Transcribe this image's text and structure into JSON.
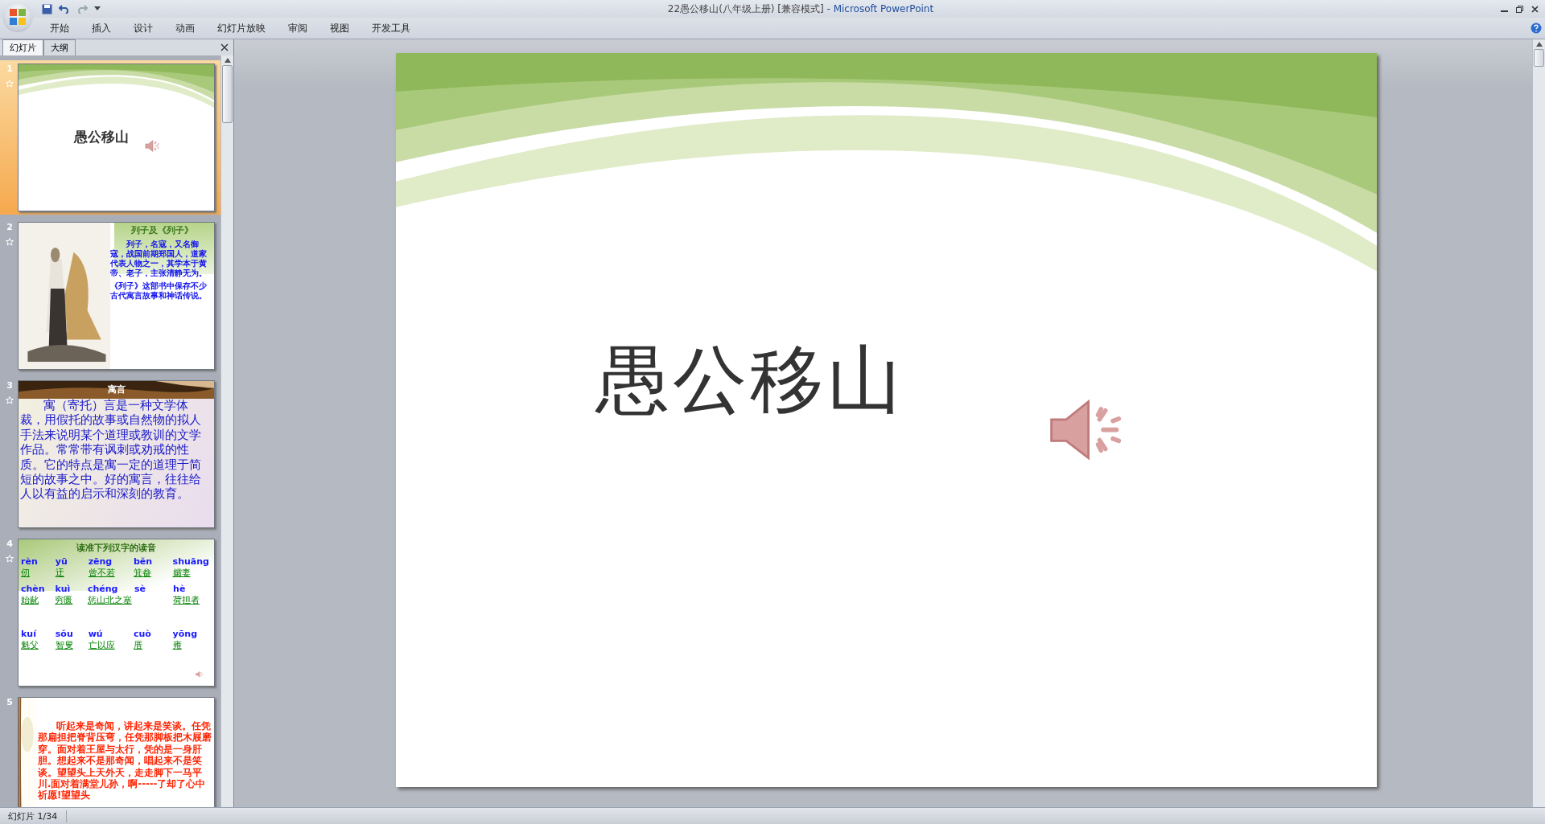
{
  "window": {
    "title": "22愚公移山(八年级上册) [兼容模式]",
    "app": " - Microsoft PowerPoint"
  },
  "ribbon_tabs": [
    "开始",
    "插入",
    "设计",
    "动画",
    "幻灯片放映",
    "审阅",
    "视图",
    "开发工具"
  ],
  "panel_tabs": [
    {
      "label": "幻灯片",
      "selected": true
    },
    {
      "label": "大纲",
      "selected": false
    }
  ],
  "slides": [
    {
      "number": "1",
      "selected": true,
      "animated": true,
      "kind": "title",
      "title": "愚公移山",
      "has_sound": true
    },
    {
      "number": "2",
      "selected": false,
      "animated": true,
      "kind": "picture_text",
      "heading": "列子及《列子》",
      "paragraphs": [
        "列子，名寇，又名御寇，战国前期郑国人，道家代表人物之一，其学本于黄帝、老子，主张清静无为。",
        "《列子》这部书中保存不少古代寓言故事和神话传说。"
      ]
    },
    {
      "number": "3",
      "selected": false,
      "animated": true,
      "kind": "text",
      "heading": "寓言",
      "paragraphs": [
        "寓（寄托）言是一种文学体裁，用假托的故事或自然物的拟人手法来说明某个道理或教训的文学作品。常常带有讽刺或劝戒的性质。它的特点是寓一定的道理于简短的故事之中。好的寓言，往往给人以有益的启示和深刻的教育。"
      ]
    },
    {
      "number": "4",
      "selected": false,
      "animated": true,
      "kind": "pinyin",
      "heading": "读准下列汉字的读音",
      "has_sound": true,
      "rows": [
        [
          {
            "pinyin": "rèn",
            "chars": "仞"
          },
          {
            "pinyin": "yū",
            "chars": "迂"
          },
          {
            "pinyin": "zēng",
            "chars": "曾不若"
          },
          {
            "pinyin": "běn",
            "chars": "箕畚"
          },
          {
            "pinyin": "shuāng",
            "chars": "孀妻"
          }
        ],
        [
          {
            "pinyin": "chèn",
            "chars": "始龀"
          },
          {
            "pinyin": "kuì",
            "chars": "穷匮"
          },
          {
            "pinyin": "chéng",
            "chars": "惩山北之塞"
          },
          {
            "pinyin": "sè"
          },
          {
            "pinyin": "hè",
            "chars": "荷担者"
          }
        ],
        [
          {
            "pinyin": "kuí",
            "chars": "魁父"
          },
          {
            "pinyin": "sǒu",
            "chars": "智叟"
          },
          {
            "pinyin": "wú",
            "chars": "亡以应"
          },
          {
            "pinyin": "cuò",
            "chars": "厝"
          },
          {
            "pinyin": "yōng",
            "chars": "雍"
          }
        ]
      ]
    },
    {
      "number": "5",
      "selected": false,
      "animated": false,
      "kind": "poem",
      "paragraphs": [
        "听起来是奇闻，讲起来是笑谈。任凭那扁担把脊背压弯，任凭那脚板把木屐磨穿。面对着王屋与太行，凭的是一身肝胆。想起来不是那奇闻，唱起来不是笑谈。望望头上天外天，走走脚下一马平川.面对着满堂儿孙，啊-----了却了心中祈愿!望望头"
      ]
    }
  ],
  "main_slide": {
    "title": "愚公移山",
    "has_sound": true
  },
  "status_bar": {
    "slide_info": "幻灯片 1/34"
  }
}
